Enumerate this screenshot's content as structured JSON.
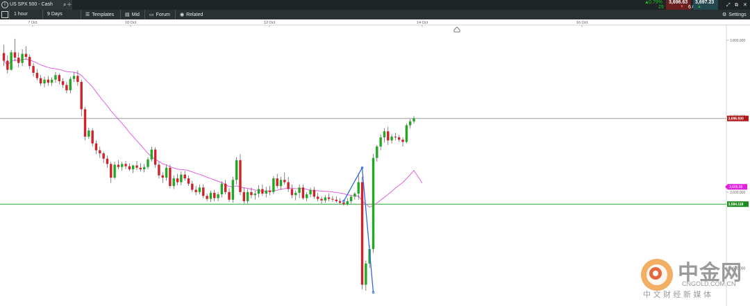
{
  "header": {
    "instrument": "US SPX 500 - Cash",
    "change_pct": "0.79%",
    "change_points": "29",
    "bid": "3,696.63",
    "spread": "6.0",
    "ask": "3,697.23"
  },
  "toolbar": {
    "interval": "1 hour",
    "range": "9 Days",
    "templates": "Templates",
    "mid": "Mid",
    "forum": "Forum",
    "related": "Related",
    "settings": "Settings"
  },
  "colors": {
    "up": "#22a822",
    "down": "#d0222a",
    "ma": "#e060e0",
    "support": "#2aa52a",
    "price_line": "#9a9a9a",
    "pattern": "#3366dd"
  },
  "chart_data": {
    "type": "candlestick",
    "x_labels": [
      "7 Oct",
      "10 Oct",
      "12 Oct",
      "14 Oct",
      "16 Oct"
    ],
    "y_ticks": [
      "3,800.000",
      "3,700.000",
      "3,600.000",
      "3,500.000"
    ],
    "ylim": [
      3450,
      3820
    ],
    "price_line": {
      "value": 3696.93,
      "label": "3,696.930"
    },
    "support_line": {
      "value": 3584.118,
      "label": "3,584.118"
    },
    "ma_label": "3,606.95",
    "candles": [
      [
        3783,
        3794,
        3766,
        3773
      ],
      [
        3773,
        3780,
        3756,
        3761
      ],
      [
        3761,
        3787,
        3760,
        3784
      ],
      [
        3784,
        3802,
        3772,
        3777
      ],
      [
        3777,
        3784,
        3764,
        3770
      ],
      [
        3770,
        3788,
        3766,
        3782
      ],
      [
        3782,
        3792,
        3775,
        3778
      ],
      [
        3778,
        3781,
        3762,
        3766
      ],
      [
        3766,
        3770,
        3752,
        3757
      ],
      [
        3757,
        3762,
        3747,
        3750
      ],
      [
        3750,
        3754,
        3740,
        3743
      ],
      [
        3743,
        3752,
        3738,
        3748
      ],
      [
        3748,
        3753,
        3740,
        3744
      ],
      [
        3744,
        3751,
        3740,
        3748
      ],
      [
        3748,
        3758,
        3744,
        3754
      ],
      [
        3754,
        3756,
        3742,
        3746
      ],
      [
        3746,
        3750,
        3737,
        3741
      ],
      [
        3741,
        3745,
        3730,
        3734
      ],
      [
        3734,
        3752,
        3730,
        3749
      ],
      [
        3749,
        3758,
        3745,
        3753
      ],
      [
        3753,
        3760,
        3740,
        3745
      ],
      [
        3745,
        3748,
        3700,
        3709
      ],
      [
        3709,
        3712,
        3668,
        3673
      ],
      [
        3673,
        3685,
        3670,
        3681
      ],
      [
        3681,
        3684,
        3660,
        3664
      ],
      [
        3664,
        3668,
        3650,
        3655
      ],
      [
        3655,
        3660,
        3645,
        3651
      ],
      [
        3651,
        3653,
        3638,
        3644
      ],
      [
        3644,
        3648,
        3632,
        3637
      ],
      [
        3637,
        3640,
        3612,
        3619
      ],
      [
        3619,
        3640,
        3617,
        3636
      ],
      [
        3636,
        3642,
        3630,
        3633
      ],
      [
        3633,
        3640,
        3628,
        3637
      ],
      [
        3637,
        3641,
        3630,
        3634
      ],
      [
        3634,
        3638,
        3628,
        3630
      ],
      [
        3630,
        3636,
        3625,
        3635
      ],
      [
        3635,
        3641,
        3629,
        3632
      ],
      [
        3632,
        3638,
        3627,
        3630
      ],
      [
        3630,
        3637,
        3626,
        3633
      ],
      [
        3633,
        3646,
        3630,
        3643
      ],
      [
        3643,
        3660,
        3640,
        3656
      ],
      [
        3656,
        3659,
        3632,
        3636
      ],
      [
        3636,
        3640,
        3618,
        3622
      ],
      [
        3622,
        3626,
        3612,
        3619
      ],
      [
        3619,
        3636,
        3615,
        3632
      ],
      [
        3632,
        3636,
        3605,
        3608
      ],
      [
        3608,
        3622,
        3604,
        3618
      ],
      [
        3618,
        3624,
        3609,
        3613
      ],
      [
        3613,
        3627,
        3609,
        3623
      ],
      [
        3623,
        3628,
        3615,
        3618
      ],
      [
        3618,
        3622,
        3608,
        3611
      ],
      [
        3611,
        3615,
        3600,
        3603
      ],
      [
        3603,
        3608,
        3596,
        3600
      ],
      [
        3600,
        3610,
        3597,
        3606
      ],
      [
        3606,
        3610,
        3592,
        3595
      ],
      [
        3595,
        3598,
        3588,
        3591
      ],
      [
        3591,
        3602,
        3587,
        3599
      ],
      [
        3599,
        3603,
        3588,
        3592
      ],
      [
        3592,
        3600,
        3588,
        3597
      ],
      [
        3597,
        3614,
        3593,
        3611
      ],
      [
        3611,
        3616,
        3597,
        3600
      ],
      [
        3600,
        3605,
        3587,
        3590
      ],
      [
        3590,
        3620,
        3586,
        3616
      ],
      [
        3616,
        3646,
        3610,
        3642
      ],
      [
        3642,
        3650,
        3596,
        3600
      ],
      [
        3600,
        3606,
        3585,
        3588
      ],
      [
        3588,
        3604,
        3585,
        3600
      ],
      [
        3600,
        3606,
        3592,
        3596
      ],
      [
        3596,
        3602,
        3590,
        3598
      ],
      [
        3598,
        3609,
        3593,
        3604
      ],
      [
        3604,
        3610,
        3595,
        3598
      ],
      [
        3598,
        3607,
        3593,
        3602
      ],
      [
        3602,
        3608,
        3596,
        3600
      ],
      [
        3600,
        3621,
        3597,
        3618
      ],
      [
        3618,
        3624,
        3605,
        3608
      ],
      [
        3608,
        3620,
        3603,
        3616
      ],
      [
        3616,
        3626,
        3610,
        3613
      ],
      [
        3613,
        3620,
        3600,
        3604
      ],
      [
        3604,
        3610,
        3592,
        3596
      ],
      [
        3596,
        3602,
        3589,
        3599
      ],
      [
        3599,
        3610,
        3592,
        3606
      ],
      [
        3606,
        3610,
        3590,
        3592
      ],
      [
        3592,
        3600,
        3588,
        3597
      ],
      [
        3597,
        3606,
        3593,
        3603
      ],
      [
        3603,
        3607,
        3591,
        3594
      ],
      [
        3594,
        3599,
        3588,
        3591
      ],
      [
        3591,
        3594,
        3585,
        3589
      ],
      [
        3589,
        3596,
        3586,
        3593
      ],
      [
        3593,
        3598,
        3588,
        3591
      ],
      [
        3591,
        3595,
        3587,
        3590
      ],
      [
        3590,
        3594,
        3586,
        3588
      ],
      [
        3588,
        3592,
        3584,
        3586
      ],
      [
        3586,
        3590,
        3582,
        3584
      ],
      [
        3584,
        3592,
        3582,
        3588
      ],
      [
        3588,
        3596,
        3585,
        3594
      ],
      [
        3594,
        3600,
        3590,
        3598
      ],
      [
        3598,
        3625,
        3590,
        3613
      ],
      [
        3613,
        3620,
        3472,
        3478
      ],
      [
        3478,
        3510,
        3470,
        3506
      ],
      [
        3506,
        3530,
        3500,
        3525
      ],
      [
        3525,
        3650,
        3520,
        3645
      ],
      [
        3645,
        3662,
        3640,
        3660
      ],
      [
        3660,
        3676,
        3655,
        3672
      ],
      [
        3672,
        3684,
        3665,
        3680
      ],
      [
        3680,
        3686,
        3662,
        3668
      ],
      [
        3668,
        3676,
        3664,
        3673
      ],
      [
        3673,
        3678,
        3668,
        3672
      ],
      [
        3672,
        3675,
        3666,
        3669
      ],
      [
        3669,
        3672,
        3660,
        3666
      ],
      [
        3666,
        3690,
        3664,
        3688
      ],
      [
        3688,
        3696,
        3684,
        3693
      ],
      [
        3693,
        3700,
        3690,
        3697
      ]
    ]
  },
  "watermark": {
    "brand_cn": "中金网",
    "brand_en": "CNGOLD.COM.CN",
    "tagline": "中 文 财 经 新 媒 体"
  }
}
